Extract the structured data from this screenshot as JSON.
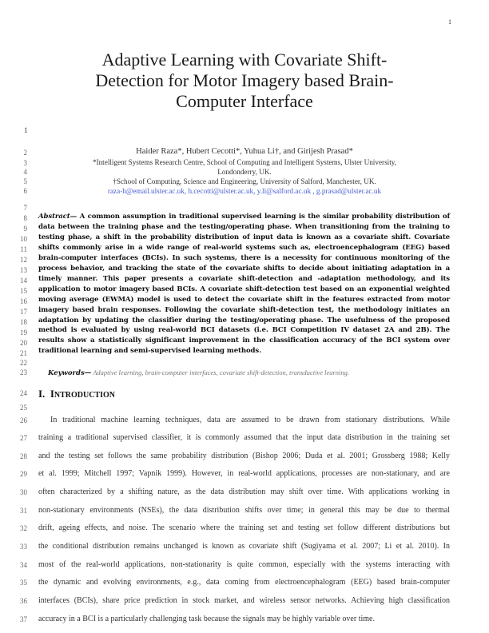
{
  "page_number": "1",
  "title_lines": [
    "Adaptive Learning with Covariate Shift-",
    "Detection for Motor Imagery based Brain-",
    "Computer Interface"
  ],
  "line_numbers": [
    "1",
    "2",
    "3",
    "4",
    "5",
    "6",
    "7",
    "8",
    "9",
    "10",
    "11",
    "12",
    "13",
    "14",
    "15",
    "16",
    "17",
    "18",
    "19",
    "20",
    "21",
    "22",
    "23",
    "24",
    "25",
    "26",
    "27",
    "28",
    "29",
    "30",
    "31",
    "32",
    "33",
    "34",
    "35",
    "36",
    "37"
  ],
  "authors": "Haider Raza*, Hubert Cecotti*, Yuhua Li†, and Girijesh Prasad*",
  "affiliations": [
    "*Intelligent Systems Research Centre, School of Computing and Intelligent Systems, Ulster University,",
    "Londonderry, UK.",
    "†School of Computing, Science and Engineering, University of Salford, Manchester, UK."
  ],
  "emails": "raza-h@email.ulster.ac.uk, h.cecotti@ulster.ac.uk, y.li@salford.ac.uk , g.prasad@ulster.ac.uk",
  "abstract": {
    "label": "Abstract—",
    "text": " A common assumption in traditional supervised learning is the similar probability distribution of data between the training phase and the testing/operating phase. When transitioning from the training to testing phase, a shift in the probability distribution of input data is known as a covariate shift. Covariate shifts commonly arise in a wide range of real-world systems such as, electroencephalogram (EEG) based brain-computer interfaces (BCIs). In such systems, there is a necessity for continuous monitoring of the process behavior, and tracking the state of the covariate shifts to decide about initiating adaptation in a timely manner. This paper presents a covariate shift-detection and -adaptation methodology, and its application to motor imagery based BCIs. A covariate shift-detection test based on an exponential weighted moving average (EWMA) model is used to detect the covariate shift in the features extracted from motor imagery based brain responses. Following the covariate shift-detection test, the methodology initiates an adaptation by updating the classifier during the testing/operating phase. The usefulness of the proposed method is evaluated by using real-world BCI datasets (i.e. BCI Competition IV dataset 2A and 2B). The results show a statistically significant improvement in the classification accuracy of the BCI system over traditional learning and semi-supervised learning methods."
  },
  "keywords": {
    "label": "Keywords—",
    "text": " Adaptive learning, brain-computer interfaces, covariate shift-detection, transductive learning."
  },
  "section": {
    "number": "I.",
    "title_initial": "I",
    "title_rest": "NTRODUCTION"
  },
  "body_lines": [
    "In traditional machine learning techniques, data are assumed to be drawn from stationary distributions. While",
    "training a traditional supervised classifier, it is commonly assumed that the input data distribution in the training set",
    "and the testing set follows the same probability distribution (Bishop 2006; Duda et al. 2001; Grossberg 1988; Kelly",
    "et al. 1999; Mitchell 1997; Vapnik 1999). However, in real-world applications, processes are non-stationary, and are",
    "often characterized by a shifting nature, as the data distribution may shift over time. With applications working in",
    "non-stationary environments (NSEs), the data distribution shifts over time; in general this may be due to thermal",
    "drift, ageing effects, and noise. The scenario where the training set and testing set follow different distributions but",
    "the conditional distribution remains unchanged is known as covariate shift (Sugiyama et al. 2007; Li et al. 2010). In",
    "most of the real-world applications, non-stationarity is quite common, especially with the systems interacting with",
    "the dynamic and evolving environments, e.g., data coming from electroencephalogram (EEG) based brain-computer",
    "interfaces (BCIs), share price prediction in stock market, and wireless sensor networks. Achieving high classification",
    "accuracy in a BCI is a particularly challenging task because the signals may be highly variable over time."
  ]
}
